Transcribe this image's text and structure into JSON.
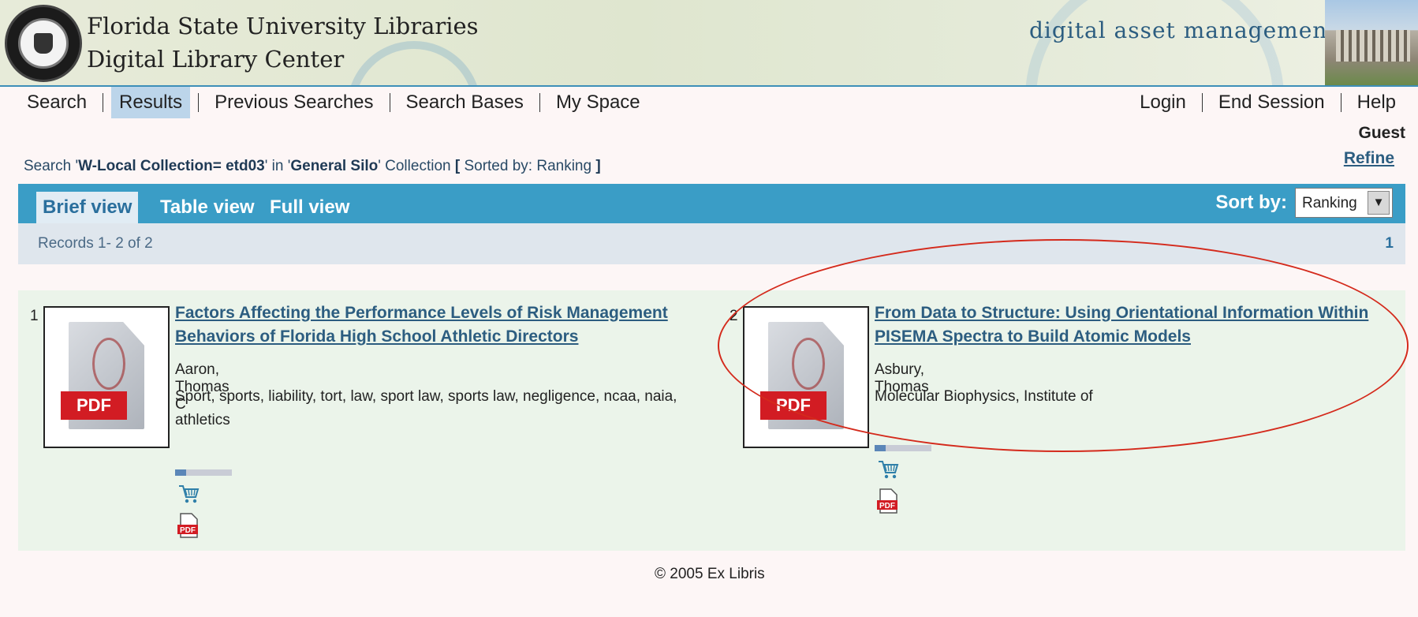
{
  "header": {
    "org_line1": "Florida State University Libraries",
    "org_line2": "Digital Library Center",
    "product": "digital asset management"
  },
  "nav": {
    "left": [
      "Search",
      "Results",
      "Previous Searches",
      "Search Bases",
      "My Space"
    ],
    "active": "Results",
    "right": [
      "Login",
      "End Session",
      "Help"
    ]
  },
  "user": {
    "name": "Guest",
    "refine": "Refine"
  },
  "search_summary": {
    "prefix": "Search '",
    "query": "W-Local Collection= etd03",
    "mid": "' in '",
    "collection": "General Silo",
    "suffix": "' Collection ",
    "sort_open": "[",
    "sort_text": " Sorted by: Ranking ",
    "sort_close": "]"
  },
  "views": {
    "brief": "Brief view",
    "table": "Table view",
    "full": "Full view"
  },
  "sort": {
    "label": "Sort by:",
    "value": "Ranking"
  },
  "records": {
    "summary": "Records 1- 2 of 2",
    "page": "1"
  },
  "results": [
    {
      "num": "1",
      "title_line1": "Factors Affecting the Performance Levels of Risk Management",
      "title_line2": "Behaviors of Florida High School Athletic Directors",
      "author": "Aaron, Thomas C",
      "subject_line1": "Sport, sports, liability, tort, law, sport law, sports law, negligence, ncaa, naia,",
      "subject_line2": "athletics",
      "thumb_label": "PDF",
      "relevance": 0.2
    },
    {
      "num": "2",
      "title_line1": "From Data to Structure: Using Orientational Information Within",
      "title_line2": "PISEMA Spectra to Build Atomic Models",
      "author": "Asbury, Thomas",
      "subject_line1": "Molecular Biophysics, Institute of",
      "thumb_label": "PDF",
      "relevance": 0.2
    }
  ],
  "footer": "© 2005 Ex Libris",
  "annotation_color": "#d42a1c",
  "icons": [
    "fsu-seal-icon",
    "cart-icon",
    "pdf-icon",
    "chevron-down-icon"
  ]
}
